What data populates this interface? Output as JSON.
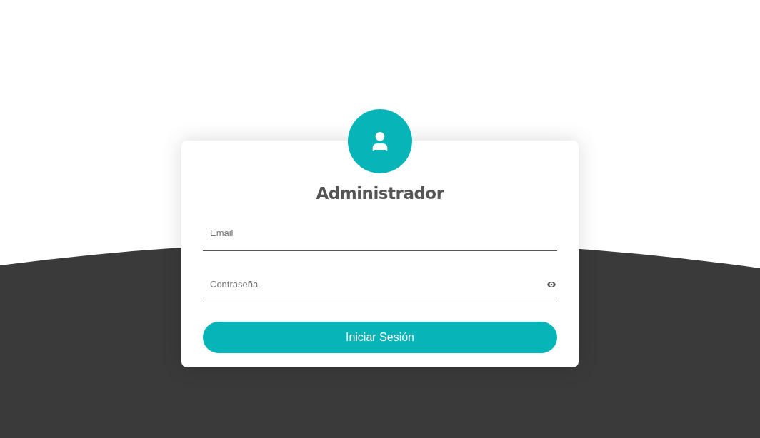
{
  "login_card": {
    "title": "Administrador",
    "fields": [
      {
        "kind": "email",
        "placeholder": "Email"
      },
      {
        "kind": "password",
        "placeholder": "Contraseña"
      }
    ],
    "submit_button": "Iniciar Sesión"
  }
}
